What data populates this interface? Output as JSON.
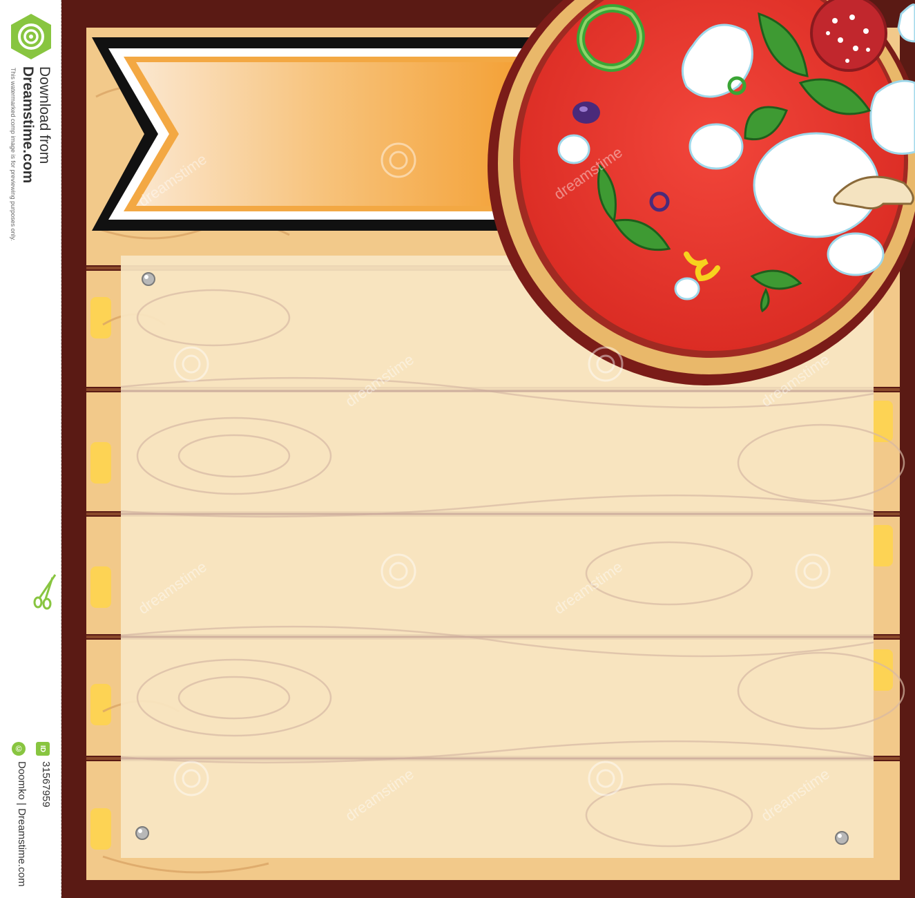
{
  "watermark": {
    "download_label": "Download from",
    "site_name": "Dreamstime.com",
    "preview_note": "This watermarked comp image is for previewing purposes only.",
    "id_badge": "ID",
    "image_id": "31567959",
    "copyright_symbol": "©",
    "credit": "Doomko | Dreamstime.com",
    "overlay_text": "dreamstime",
    "accent_color": "#88c540"
  },
  "illustration": {
    "subject": "pizza-menu-board",
    "colors": {
      "frame": "#5a1a14",
      "wood_light": "#f8e1b4",
      "wood_plank": "#f2c98a",
      "wood_grain": "#d9a565",
      "banner_orange": "#f4a83a",
      "pizza_sauce": "#e8342c",
      "crust": "#e9b86a",
      "mozzarella": "#ffffff",
      "basil": "#3e9a33"
    },
    "icons": [
      "dreamstime-logo-icon",
      "scissors-icon",
      "pizza-icon",
      "ribbon-banner-icon",
      "nail-icon"
    ]
  }
}
